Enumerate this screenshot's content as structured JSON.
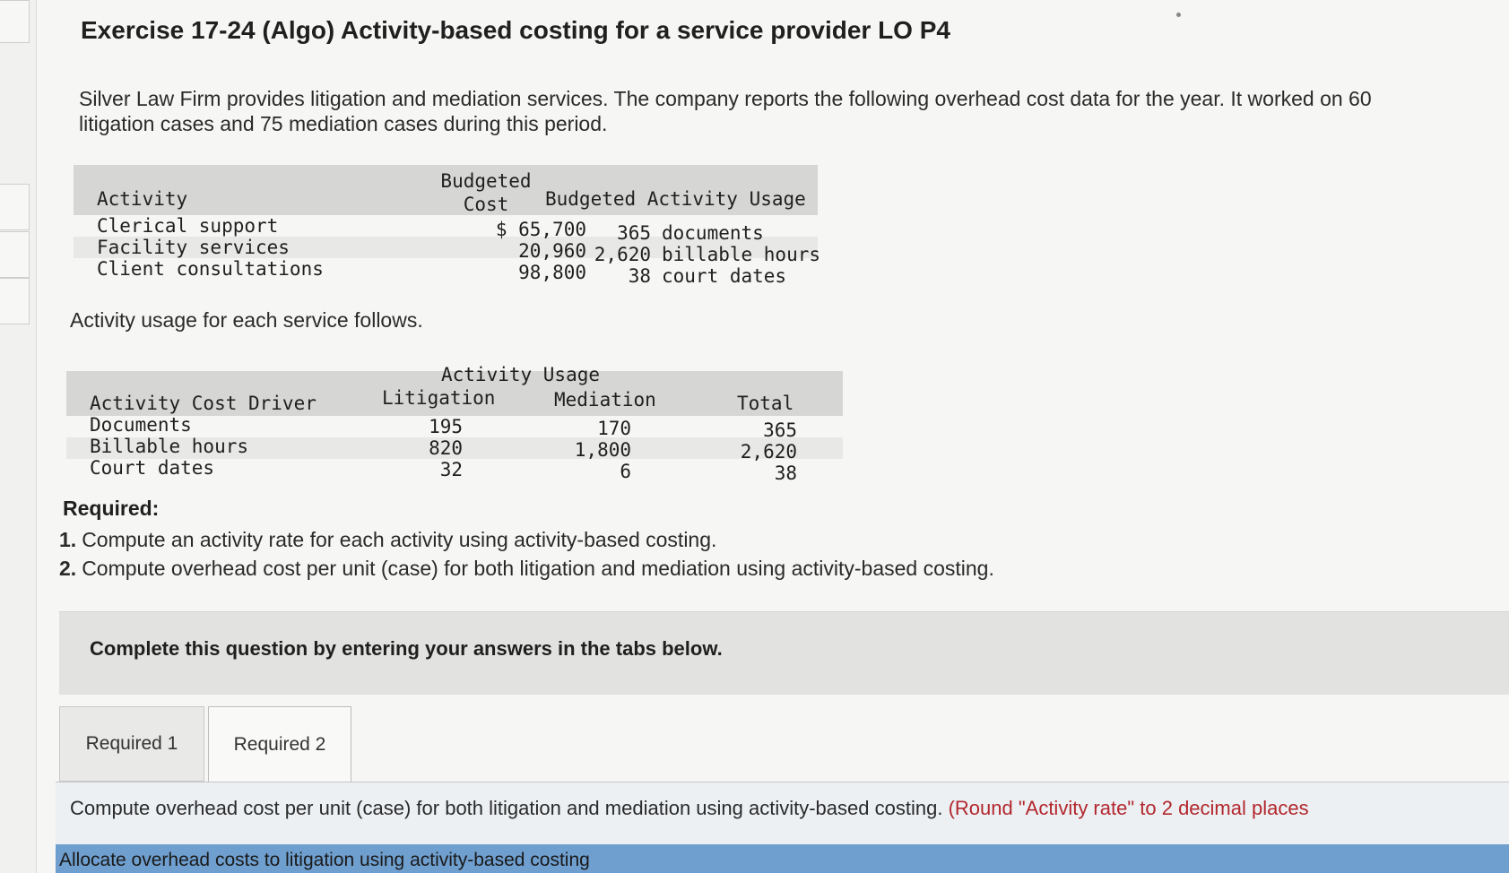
{
  "title": "Exercise 17-24 (Algo) Activity-based costing for a service provider LO P4",
  "intro": "Silver Law Firm provides litigation and mediation services. The company reports the following overhead cost data for the year. It worked on 60 litigation cases and 75 mediation cases during this period.",
  "cost_table": {
    "headers": {
      "activity": "Activity",
      "budgeted_cost_line1": "Budgeted",
      "budgeted_cost_line2": "Cost",
      "usage": "Budgeted Activity Usage"
    },
    "rows": [
      {
        "activity": "Clerical support",
        "cost": "$ 65,700",
        "usage_qty": "365",
        "usage_unit": "documents"
      },
      {
        "activity": "Facility services",
        "cost": "20,960",
        "usage_qty": "2,620",
        "usage_unit": "billable hours"
      },
      {
        "activity": "Client consultations",
        "cost": "98,800",
        "usage_qty": "38",
        "usage_unit": "court dates"
      }
    ]
  },
  "usage_caption": "Activity usage for each service follows.",
  "usage_table": {
    "headers": {
      "group": "Activity Usage",
      "driver": "Activity Cost Driver",
      "litigation": "Litigation",
      "mediation": "Mediation",
      "total": "Total"
    },
    "rows": [
      {
        "driver": "Documents",
        "litigation": "195",
        "mediation": "170",
        "total": "365"
      },
      {
        "driver": "Billable hours",
        "litigation": "820",
        "mediation": "1,800",
        "total": "2,620"
      },
      {
        "driver": "Court dates",
        "litigation": "32",
        "mediation": "6",
        "total": "38"
      }
    ]
  },
  "required": {
    "heading": "Required:",
    "items": [
      {
        "num": "1.",
        "text": "Compute an activity rate for each activity using activity-based costing."
      },
      {
        "num": "2.",
        "text": "Compute overhead cost per unit (case) for both litigation and mediation using activity-based costing."
      }
    ]
  },
  "instruction": "Complete this question by entering your answers in the tabs below.",
  "tabs": [
    {
      "label": "Required 1"
    },
    {
      "label": "Required 2"
    }
  ],
  "tab_content": {
    "text": "Compute overhead cost per unit (case) for both litigation and mediation using activity-based costing.",
    "note": "(Round \"Activity rate\" to 2 decimal places"
  },
  "allocation_bar": "Allocate overhead costs to litigation using activity-based costing"
}
